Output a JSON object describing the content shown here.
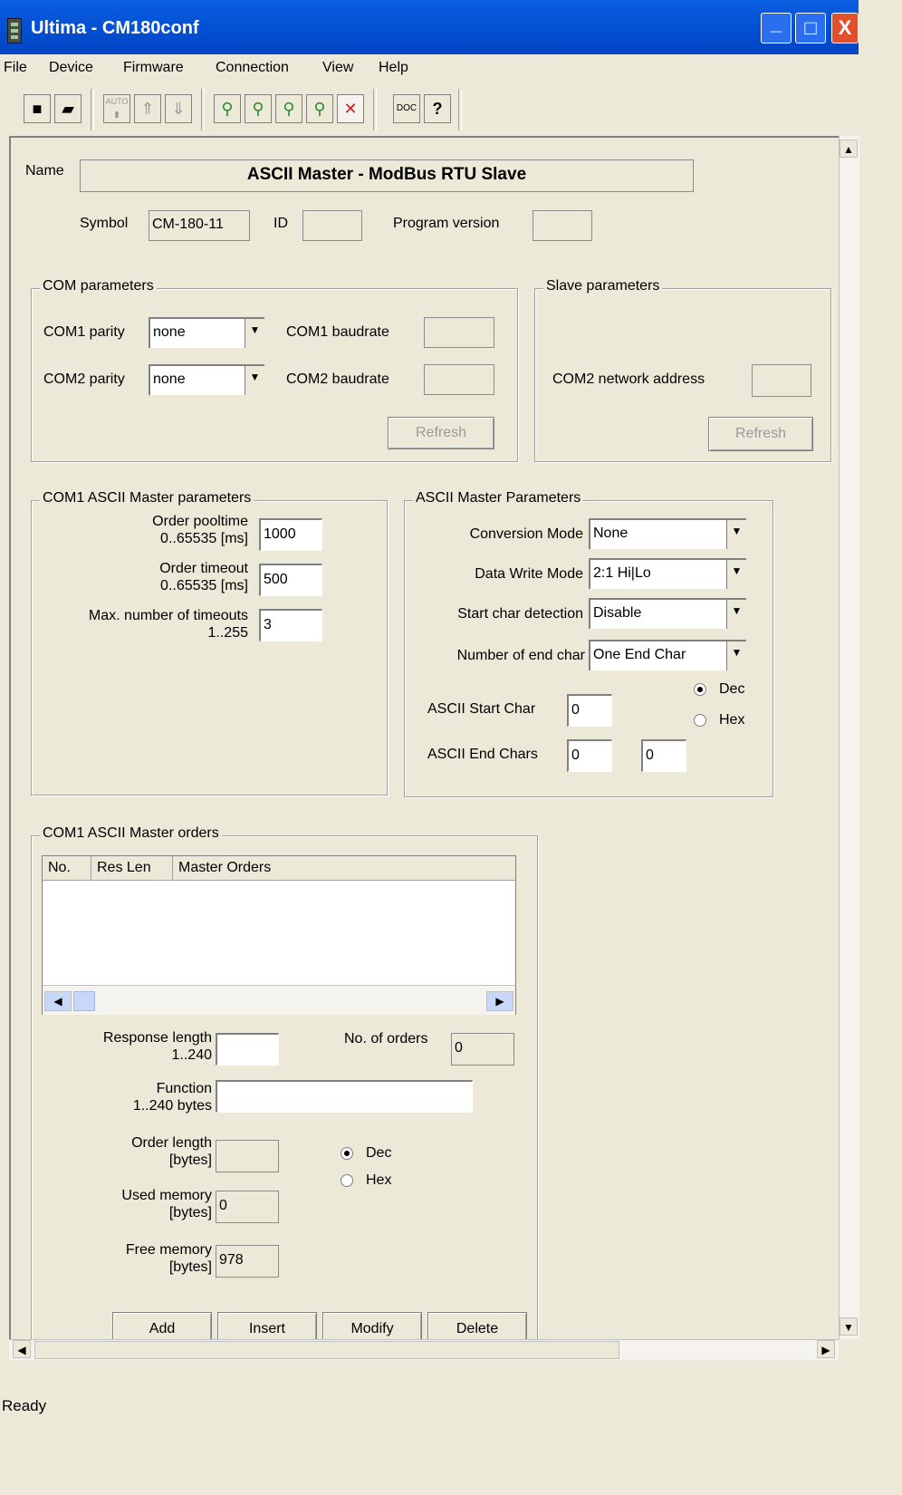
{
  "window": {
    "title": "Ultima - CM180conf",
    "min": "_",
    "max": "□",
    "close": "X"
  },
  "menu": [
    "File",
    "Device",
    "Firmware",
    "Connection",
    "View",
    "Help"
  ],
  "toolbar_icons": [
    "save-icon",
    "open-folder-icon",
    "auto-upload-icon",
    "upload-icon",
    "download-icon",
    "connect-1-icon",
    "connect-2-icon",
    "connect-3-icon",
    "connect-4-icon",
    "disconnect-icon",
    "documentation-icon",
    "help-icon"
  ],
  "name": {
    "label": "Name",
    "value": "ASCII Master - ModBus RTU Slave"
  },
  "symbol": {
    "label": "Symbol",
    "value": "CM-180-11"
  },
  "id": {
    "label": "ID",
    "value": ""
  },
  "program_version": {
    "label": "Program version",
    "value": ""
  },
  "com_params": {
    "title": "COM parameters",
    "com1_parity_label": "COM1 parity",
    "com1_parity": "none",
    "com2_parity_label": "COM2 parity",
    "com2_parity": "none",
    "com1_baud_label": "COM1 baudrate",
    "com1_baud": "",
    "com2_baud_label": "COM2 baudrate",
    "com2_baud": "",
    "refresh": "Refresh"
  },
  "slave_params": {
    "title": "Slave parameters",
    "com2_addr_label": "COM2 network address",
    "com2_addr": "",
    "refresh": "Refresh"
  },
  "com1_master": {
    "title": "COM1 ASCII Master parameters",
    "pooltime_label1": "Order pooltime",
    "pooltime_label2": "0..65535 [ms]",
    "pooltime": "1000",
    "timeout_label1": "Order timeout",
    "timeout_label2": "0..65535 [ms]",
    "timeout": "500",
    "maxto_label1": "Max. number of timeouts",
    "maxto_label2": "1..255",
    "maxto": "3"
  },
  "ascii_master": {
    "title": "ASCII Master Parameters",
    "conv_label": "Conversion Mode",
    "conv": "None",
    "dwm_label": "Data Write Mode",
    "dwm": "2:1 Hi|Lo",
    "scd_label": "Start char detection",
    "scd": "Disable",
    "nec_label": "Number of end char",
    "nec": "One End Char",
    "start_label": "ASCII Start Char",
    "start": "0",
    "end_label": "ASCII End Chars",
    "end1": "0",
    "end2": "0",
    "dec": "Dec",
    "hex": "Hex"
  },
  "orders": {
    "title": "COM1 ASCII Master orders",
    "columns": [
      "No.",
      "Res Len",
      "Master Orders"
    ],
    "resp_label1": "Response length",
    "resp_label2": "1..240",
    "resp": "",
    "num_label": "No. of orders",
    "num": "0",
    "func_label1": "Function",
    "func_label2": "1..240 bytes",
    "func": "",
    "olen_label1": "Order length",
    "olen_label2": "[bytes]",
    "olen": "",
    "used_label1": "Used memory",
    "used_label2": "[bytes]",
    "used": "0",
    "free_label1": "Free memory",
    "free_label2": "[bytes]",
    "free": "978",
    "dec": "Dec",
    "hex": "Hex",
    "add": "Add",
    "insert": "Insert",
    "modify": "Modify",
    "delete": "Delete"
  },
  "status": "Ready"
}
